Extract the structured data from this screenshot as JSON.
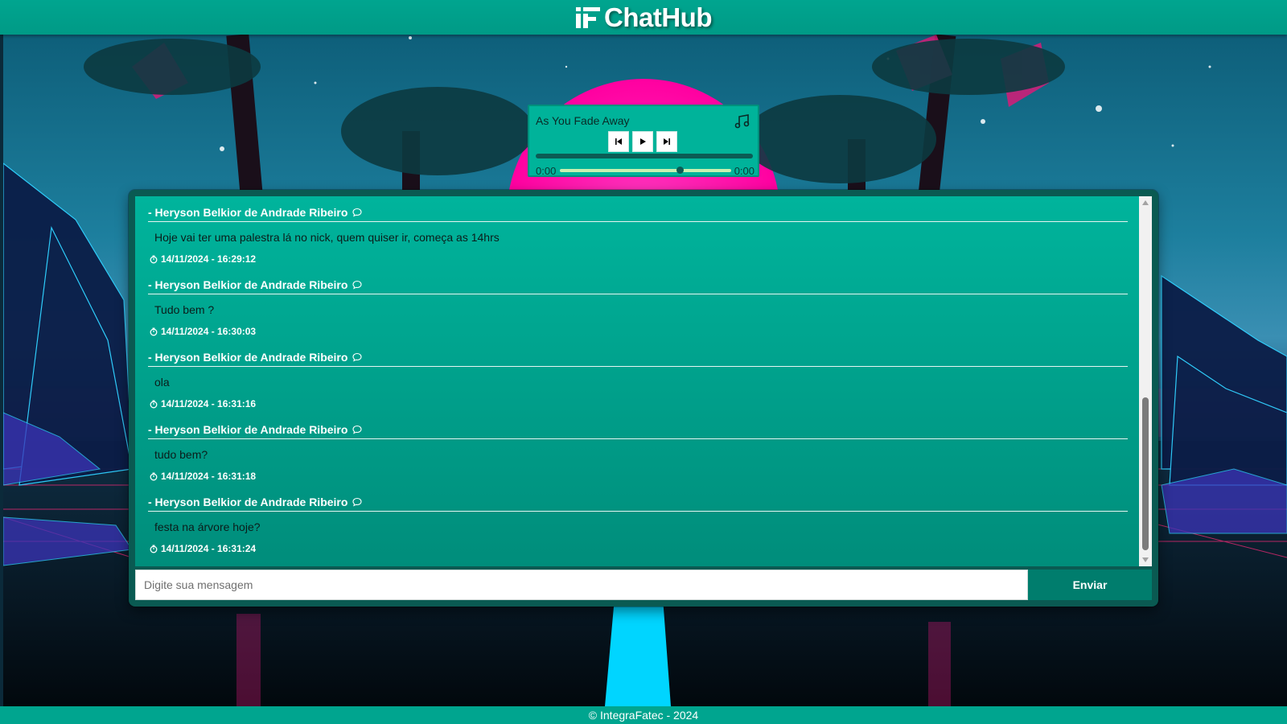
{
  "app": {
    "title": "ChatHub"
  },
  "player": {
    "track_title": "As You Fade Away",
    "current_time": "0:00",
    "duration": "0:00",
    "progress": 0,
    "seek_position": 0.7
  },
  "chat": {
    "messages": [
      {
        "author": "- Heryson Belkior de Andrade Ribeiro",
        "text": "Hoje vai ter uma palestra lá no nick, quem quiser ir, começa as 14hrs",
        "time": "14/11/2024 - 16:29:12"
      },
      {
        "author": "- Heryson Belkior de Andrade Ribeiro",
        "text": "Tudo bem ?",
        "time": "14/11/2024 - 16:30:03"
      },
      {
        "author": "- Heryson Belkior de Andrade Ribeiro",
        "text": "ola",
        "time": "14/11/2024 - 16:31:16"
      },
      {
        "author": "- Heryson Belkior de Andrade Ribeiro",
        "text": "tudo bem?",
        "time": "14/11/2024 - 16:31:18"
      },
      {
        "author": "- Heryson Belkior de Andrade Ribeiro",
        "text": "festa na árvore hoje?",
        "time": "14/11/2024 - 16:31:24"
      }
    ],
    "input_placeholder": "Digite sua mensagem",
    "send_label": "Enviar"
  },
  "footer": {
    "text": "© IntegraFatec - 2024"
  },
  "icons": {
    "logo": "integrafatec-logo-icon",
    "music": "music-note-icon",
    "prev": "skip-back-icon",
    "play": "play-icon",
    "next": "skip-forward-icon",
    "comment": "comment-bubble-icon",
    "clock": "clock-icon"
  },
  "colors": {
    "brand": "#00a58f",
    "panel": "#0a5a52",
    "sun": "#ff1aa8",
    "neon_cyan": "#00d5ff"
  }
}
